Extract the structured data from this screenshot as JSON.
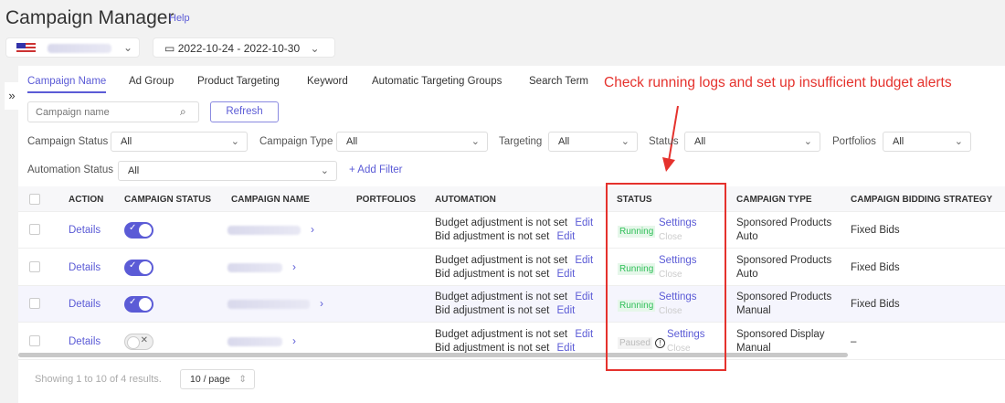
{
  "header": {
    "title": "Campaign Manager",
    "help": "Help",
    "date_range": "2022-10-24 - 2022-10-30"
  },
  "tabs": [
    "Campaign Name",
    "Ad Group",
    "Product Targeting",
    "Keyword",
    "Automatic Targeting Groups",
    "Search Term"
  ],
  "search": {
    "placeholder": "Campaign name"
  },
  "refresh": "Refresh",
  "filters": {
    "campaign_status": {
      "label": "Campaign Status",
      "value": "All"
    },
    "campaign_type": {
      "label": "Campaign Type",
      "value": "All"
    },
    "targeting": {
      "label": "Targeting",
      "value": "All"
    },
    "status": {
      "label": "Status",
      "value": "All"
    },
    "portfolios": {
      "label": "Portfolios",
      "value": "All"
    },
    "automation_status": {
      "label": "Automation Status",
      "value": "All"
    },
    "add_filter": "Add Filter"
  },
  "annotation": "Check running logs and set up insufficient budget alerts",
  "columns": [
    "ACTION",
    "CAMPAIGN STATUS",
    "CAMPAIGN NAME",
    "PORTFOLIOS",
    "AUTOMATION",
    "STATUS",
    "CAMPAIGN TYPE",
    "CAMPAIGN BIDDING STRATEGY"
  ],
  "rows": [
    {
      "action": "Details",
      "enabled": true,
      "budget": "Budget adjustment is not set",
      "bid": "Bid adjustment is not set",
      "edit": "Edit",
      "status": "Running",
      "settings": "Settings",
      "close": "Close",
      "type1": "Sponsored Products",
      "type2": "Auto",
      "bidding": "Fixed Bids"
    },
    {
      "action": "Details",
      "enabled": true,
      "budget": "Budget adjustment is not set",
      "bid": "Bid adjustment is not set",
      "edit": "Edit",
      "status": "Running",
      "settings": "Settings",
      "close": "Close",
      "type1": "Sponsored Products",
      "type2": "Auto",
      "bidding": "Fixed Bids"
    },
    {
      "action": "Details",
      "enabled": true,
      "budget": "Budget adjustment is not set",
      "bid": "Bid adjustment is not set",
      "edit": "Edit",
      "status": "Running",
      "settings": "Settings",
      "close": "Close",
      "type1": "Sponsored Products",
      "type2": "Manual",
      "bidding": "Fixed Bids"
    },
    {
      "action": "Details",
      "enabled": false,
      "budget": "Budget adjustment is not set",
      "bid": "Bid adjustment is not set",
      "edit": "Edit",
      "status": "Paused",
      "settings": "Settings",
      "close": "Close",
      "type1": "Sponsored Display",
      "type2": "Manual",
      "bidding": "–"
    }
  ],
  "footer": {
    "showing": "Showing 1 to 10 of 4 results.",
    "page_size": "10 / page"
  }
}
